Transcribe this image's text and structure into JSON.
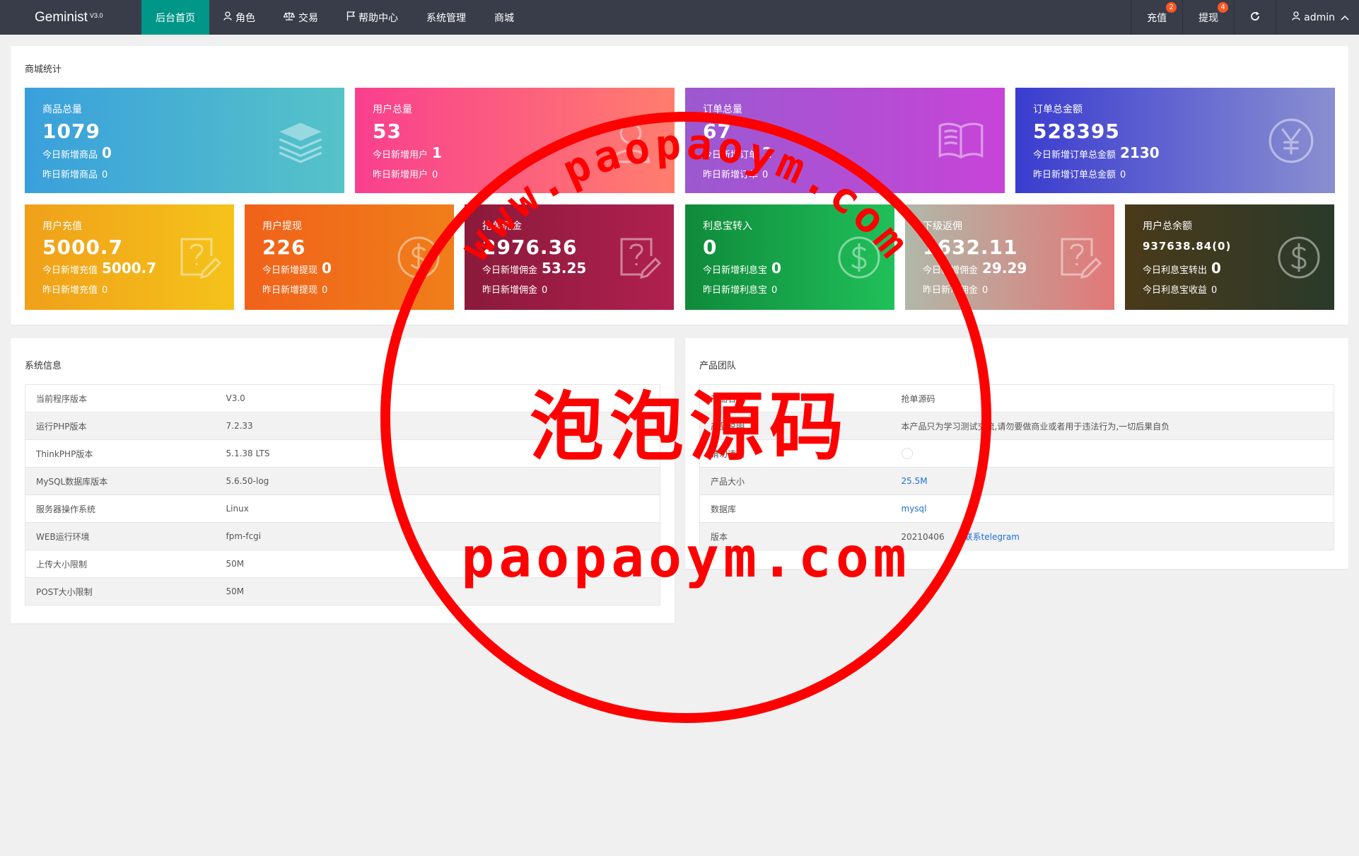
{
  "header": {
    "logo": "Geminist",
    "version": "V3.0",
    "nav": [
      {
        "label": "后台首页",
        "icon": ""
      },
      {
        "label": "角色",
        "icon": "user-icon"
      },
      {
        "label": "交易",
        "icon": "scale-icon"
      },
      {
        "label": "帮助中心",
        "icon": "flag-icon"
      },
      {
        "label": "系统管理",
        "icon": ""
      },
      {
        "label": "商城",
        "icon": ""
      }
    ],
    "right": {
      "recharge": "充值",
      "recharge_badge": "2",
      "withdraw": "提现",
      "withdraw_badge": "4",
      "admin": "admin"
    }
  },
  "stats": {
    "title": "商城统计",
    "row1": [
      {
        "title": "商品总量",
        "value": "1079",
        "l1_label": "今日新增商品",
        "l1_value": "0",
        "l2_label": "昨日新增商品",
        "l2_value": "0",
        "icon": "layers-icon",
        "gradient": [
          "#3aa0dc",
          "#55c3c8"
        ]
      },
      {
        "title": "用户总量",
        "value": "53",
        "l1_label": "今日新增用户",
        "l1_value": "1",
        "l2_label": "昨日新增用户",
        "l2_value": "0",
        "icon": "user-icon",
        "gradient": [
          "#f93f8e",
          "#ff7e6e"
        ]
      },
      {
        "title": "订单总量",
        "value": "67",
        "l1_label": "今日新增订单",
        "l1_value": "2",
        "l2_label": "昨日新增订单",
        "l2_value": "0",
        "icon": "book-icon",
        "gradient": [
          "#9b59d0",
          "#c744d8"
        ]
      },
      {
        "title": "订单总金额",
        "value": "528395",
        "l1_label": "今日新增订单总金额",
        "l1_value": "2130",
        "l2_label": "昨日新增订单总金额",
        "l2_value": "0",
        "icon": "yen-icon",
        "gradient": [
          "#3a3ccf",
          "#8a8fd0"
        ]
      }
    ],
    "row2": [
      {
        "title": "用户充值",
        "value": "5000.7",
        "l1_label": "今日新增充值",
        "l1_value": "5000.7",
        "l2_label": "昨日新增充值",
        "l2_value": "0",
        "icon": "help-edit-icon",
        "gradient": [
          "#f0a01a",
          "#f5c31a"
        ]
      },
      {
        "title": "用户提现",
        "value": "226",
        "l1_label": "今日新增提现",
        "l1_value": "0",
        "l2_label": "昨日新增提现",
        "l2_value": "0",
        "icon": "dollar-icon",
        "gradient": [
          "#f0621a",
          "#f07e1a"
        ]
      },
      {
        "title": "抢单佣金",
        "value": "2976.36",
        "l1_label": "今日新增佣金",
        "l1_value": "53.25",
        "l2_label": "昨日新增佣金",
        "l2_value": "0",
        "icon": "help-edit-icon",
        "gradient": [
          "#8a1a3a",
          "#b02050"
        ]
      },
      {
        "title": "利息宝转入",
        "value": "0",
        "l1_label": "今日新增利息宝",
        "l1_value": "0",
        "l2_label": "昨日新增利息宝",
        "l2_value": "0",
        "icon": "dollar-icon",
        "gradient": [
          "#0f8a3a",
          "#20c05a"
        ]
      },
      {
        "title": "下级返佣",
        "value": "1632.11",
        "l1_label": "今日新增佣金",
        "l1_value": "29.29",
        "l2_label": "昨日新增佣金",
        "l2_value": "0",
        "icon": "help-edit-icon",
        "gradient": [
          "#b0b8a8",
          "#e27878"
        ]
      },
      {
        "title": "用户总余额",
        "value": "937638.84(0)",
        "l1_label": "今日利息宝转出",
        "l1_value": "0",
        "l2_label": "今日利息宝收益",
        "l2_value": "0",
        "icon": "dollar-icon",
        "gradient": [
          "#4a3a1a",
          "#2a3a2a"
        ]
      }
    ]
  },
  "sysinfo": {
    "title": "系统信息",
    "rows": [
      [
        "当前程序版本",
        "V3.0"
      ],
      [
        "运行PHP版本",
        "7.2.33"
      ],
      [
        "ThinkPHP版本",
        "5.1.38 LTS"
      ],
      [
        "MySQL数据库版本",
        "5.6.50-log"
      ],
      [
        "服务器操作系统",
        "Linux"
      ],
      [
        "WEB运行环境",
        "fpm-fcgi"
      ],
      [
        "上传大小限制",
        "50M"
      ],
      [
        "POST大小限制",
        "50M"
      ]
    ]
  },
  "product": {
    "title": "产品团队",
    "rows": [
      {
        "label": "产品名称",
        "value": "抢单源码",
        "link": false
      },
      {
        "label": "产品说明",
        "value": "本产品只为学习测试交流,请勿要做商业或者用于违法行为,一切后果自负",
        "link": false
      },
      {
        "label": "请勿违法",
        "value": "",
        "link": false
      },
      {
        "label": "产品大小",
        "value": "25.5M",
        "link": true
      },
      {
        "label": "数据库",
        "value": "mysql",
        "link": true
      },
      {
        "label": "版本",
        "value": "20210406",
        "link": false,
        "extra": "联系telegram"
      }
    ]
  },
  "watermark": {
    "ring_text": "www.paopaoym.com",
    "center_text": "泡泡源码",
    "bottom_text": "paopaoym.com",
    "color": "#ff0000"
  }
}
